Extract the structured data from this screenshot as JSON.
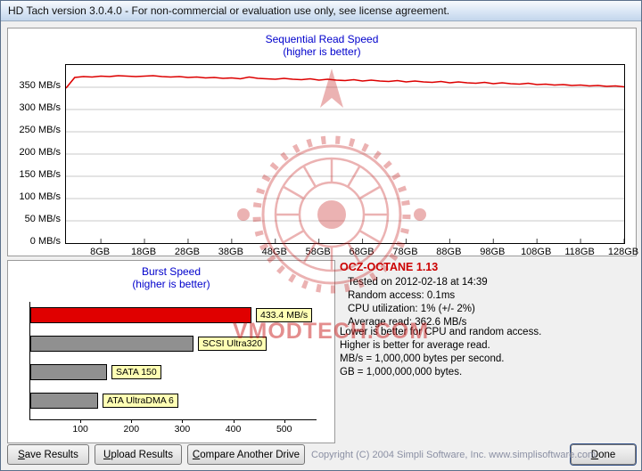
{
  "window": {
    "title": "HD Tach version 3.0.4.0  - For non-commercial or evaluation use only, see license agreement."
  },
  "watermark": {
    "text": "VMODTECH.COM"
  },
  "chart_data": [
    {
      "type": "line",
      "title": "Sequential Read Speed",
      "subtitle": "(higher is better)",
      "y_unit": "MB/s",
      "x_unit": "GB",
      "xlim": [
        0,
        128
      ],
      "ylim": [
        0,
        400
      ],
      "x_step_gb": 2,
      "x_tick_values": [
        8,
        18,
        28,
        38,
        48,
        58,
        68,
        78,
        88,
        98,
        108,
        118,
        128
      ],
      "y_tick_values": [
        350,
        300,
        250,
        200,
        150,
        100,
        50,
        0
      ],
      "grid": "horizontal",
      "series": [
        {
          "name": "Sequential read speed",
          "color": "#dd0000",
          "values": [
            348,
            372,
            374,
            373,
            375,
            374,
            376,
            375,
            374,
            375,
            376,
            374,
            373,
            374,
            372,
            373,
            371,
            372,
            370,
            371,
            369,
            373,
            370,
            369,
            368,
            370,
            368,
            367,
            369,
            366,
            368,
            366,
            365,
            367,
            364,
            366,
            364,
            363,
            365,
            362,
            364,
            362,
            361,
            363,
            360,
            362,
            360,
            359,
            361,
            358,
            360,
            358,
            357,
            359,
            356,
            357,
            355,
            356,
            354,
            355,
            353,
            354,
            352,
            353,
            351
          ]
        }
      ]
    },
    {
      "type": "bar",
      "title": "Burst Speed",
      "subtitle": "(higher is better)",
      "xlim": [
        0,
        560
      ],
      "x_tick_values": [
        100,
        200,
        300,
        400,
        500
      ],
      "bars": [
        {
          "label": "433.4 MB/s",
          "value": 433.4,
          "color": "#e00000"
        },
        {
          "label": "SCSI Ultra320",
          "value": 320,
          "color": "#909090"
        },
        {
          "label": "SATA 150",
          "value": 150,
          "color": "#909090"
        },
        {
          "label": "ATA UltraDMA 6",
          "value": 133,
          "color": "#909090"
        }
      ]
    }
  ],
  "info_panel": {
    "drive_name": "OCZ-OCTANE 1.13",
    "lines": [
      "Tested on 2012-02-18 at 14:39",
      "Random access: 0.1ms",
      "CPU utilization: 1% (+/- 2%)",
      "Average read: 362.6 MB/s"
    ],
    "notes": [
      "Lower is better for CPU and random access.",
      "Higher is better for average read.",
      "MB/s = 1,000,000 bytes per second.",
      "GB = 1,000,000,000 bytes."
    ]
  },
  "buttons": {
    "save": {
      "key": "S",
      "rest": "ave Results"
    },
    "upload": {
      "key": "U",
      "rest": "pload Results"
    },
    "compare": {
      "key": "C",
      "rest": "ompare Another Drive"
    },
    "done": {
      "key": "D",
      "rest": "one"
    }
  },
  "footer": {
    "copyright": "Copyright (C) 2004 Simpli Software, Inc.  www.simplisoftware.com"
  }
}
